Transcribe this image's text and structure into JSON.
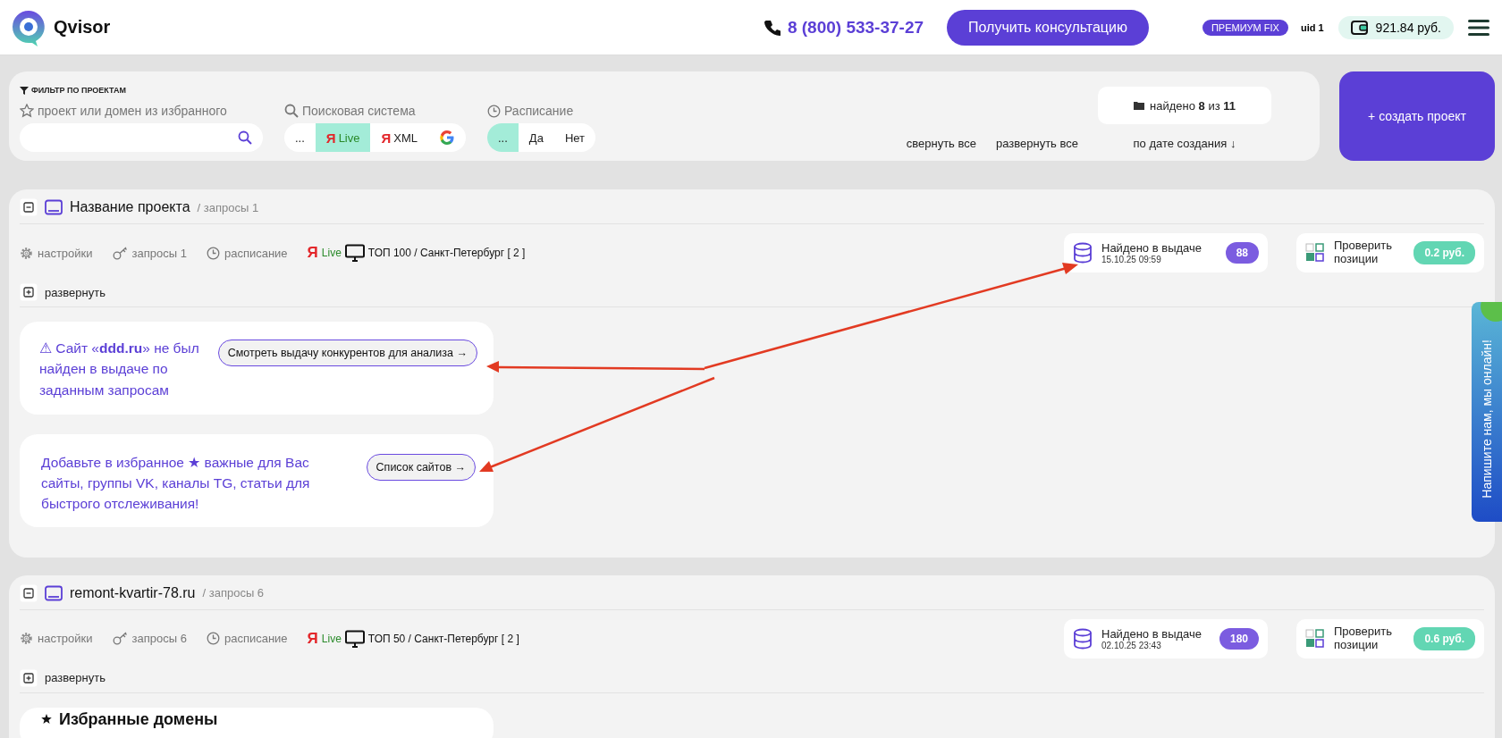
{
  "header": {
    "logo": "Qvisor",
    "phone": "8 (800) 533-37-27",
    "consult_button": "Получить консультацию",
    "plan_badge": "ПРЕМИУМ FIX",
    "uid": "uid 1",
    "balance": "921.84 руб."
  },
  "filter": {
    "title": "ФИЛЬТР ПО ПРОЕКТАМ",
    "favorite_label": "проект или домен из избранного",
    "engine_label": "Поисковая система",
    "engines": [
      {
        "kind": "any",
        "label": "...",
        "selected": false
      },
      {
        "kind": "yandex",
        "mark": "Я",
        "label": "Live",
        "selected": true
      },
      {
        "kind": "yandex",
        "mark": "Я",
        "label": "XML",
        "selected": false
      },
      {
        "kind": "google",
        "selected": false
      }
    ],
    "schedule_label": "Расписание",
    "schedule_options": [
      {
        "label": "...",
        "selected": true
      },
      {
        "label": "Да",
        "selected": false
      },
      {
        "label": "Нет",
        "selected": false
      }
    ],
    "found": "найдено **8** из **11**",
    "collapse_all": "свернуть все",
    "expand_all": "развернуть все",
    "sort": "по дате создания ↓"
  },
  "create_button": "+ создать проект",
  "projects": [
    {
      "name": "Название проекта",
      "queries_note": "/ запросы 1",
      "expanded": true,
      "settings": "настройки",
      "queries": "запросы 1",
      "schedule": "расписание",
      "engine_mark": "Я",
      "engine": "Live",
      "region": "ТОП 100 / Санкт-Петербург [ 2 ]",
      "found_label": "Найдено в выдаче",
      "found_date": "15.10.25 09:59",
      "found_count": "88",
      "check_label": "Проверить позиции",
      "check_price": "0.2 руб.",
      "toggle": "развернуть",
      "notices": [
        {
          "kind": "warning",
          "text": "⚠ Сайт «**ddd.ru**» не был найден в выдаче по заданным запросам",
          "button": "Смотреть выдачу конкурентов для анализа →"
        },
        {
          "kind": "favorites",
          "text": "Добавьте в избранное ★ важные для Вас сайты, группы VK, каналы TG, статьи для быстрого отслеживания!",
          "button": "Список сайтов →"
        }
      ]
    },
    {
      "name": "remont-kvartir-78.ru",
      "queries_note": "/ запросы 6",
      "expanded": true,
      "settings": "настройки",
      "queries": "запросы 6",
      "schedule": "расписание",
      "engine_mark": "Я",
      "engine": "Live",
      "region": "ТОП 50 / Санкт-Петербург [ 2 ]",
      "found_label": "Найдено в выдаче",
      "found_date": "02.10.25 23:43",
      "found_count": "180",
      "check_label": "Проверить позиции",
      "check_price": "0.6 руб.",
      "toggle": "развернуть",
      "notices": [
        {
          "kind": "heading",
          "text": "Избранные домены"
        }
      ]
    }
  ],
  "chat_tab": "Напишите нам, мы онлайн!"
}
